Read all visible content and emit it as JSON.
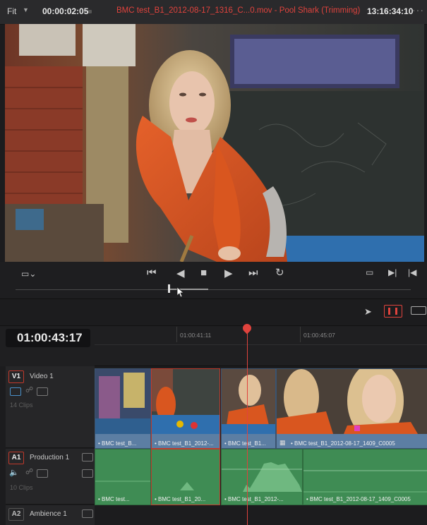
{
  "topbar": {
    "fit_label": "Fit",
    "source_timecode": "00:00:02:05",
    "title": "BMC test_B1_2012-08-17_1316_C...0.mov - Pool Shark (Trimming)",
    "record_timecode": "13:16:34:10",
    "more": "···"
  },
  "timeline": {
    "timecode": "01:00:43:17",
    "ruler": [
      "01:00:41:11",
      "01:00:45:07"
    ]
  },
  "tracks": {
    "v1": {
      "tag": "V1",
      "name": "Video 1",
      "clips_count": "14 Clips"
    },
    "a1": {
      "tag": "A1",
      "name": "Production 1",
      "clips_count": "10 Clips"
    },
    "a2": {
      "tag": "A2",
      "name": "Ambience 1"
    }
  },
  "video_clips": [
    "• BMC test_B...",
    "• BMC test_B1_2012-...",
    "• BMC test_B1...",
    "• BMC test_B1_2012-08-17_1409_C0005"
  ],
  "audio_clips": [
    "• BMC test...",
    "• BMC test_B1_20...",
    "• BMC test_B1_2012-...",
    "• BMC test_B1_2012-08-17_1409_C0005"
  ],
  "colors": {
    "accent_red": "#e0433d",
    "video_clip": "#5c7ea3",
    "audio_clip": "#3f8c54"
  }
}
